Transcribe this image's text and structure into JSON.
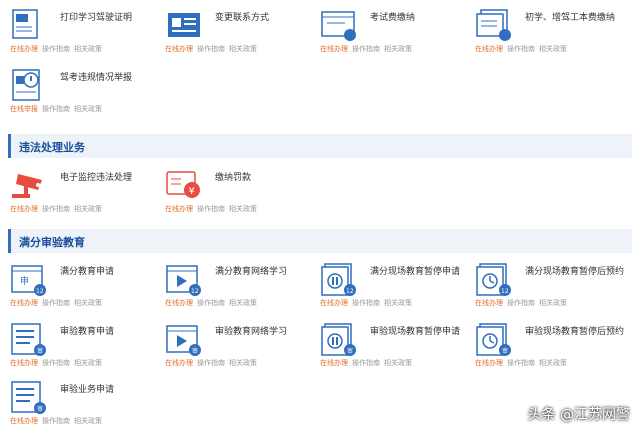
{
  "colors": {
    "accent": "#2f6fbe",
    "online": "#e06f2a",
    "section_bg": "#eef3f9",
    "section_text": "#1b4f9c",
    "icon_red": "#e84c3d"
  },
  "top_items": [
    {
      "title": "打印学习驾驶证明",
      "online": "在线办理",
      "guide": "操作指南",
      "policy": "相关政策",
      "icon": "document-stamp-icon"
    },
    {
      "title": "变更联系方式",
      "online": "在线办理",
      "guide": "操作指南",
      "policy": "相关政策",
      "icon": "contact-card-icon"
    },
    {
      "title": "考试费缴纳",
      "online": "在线办理",
      "guide": "操作指南",
      "policy": "相关政策",
      "icon": "fee-window-icon"
    },
    {
      "title": "初学、增驾工本费缴纳",
      "online": "在线办理",
      "guide": "操作指南",
      "policy": "相关政策",
      "icon": "fee-document-icon"
    },
    {
      "title": "驾考违规情况举报",
      "online": "在线举报",
      "guide": "操作指南",
      "policy": "相关政策",
      "icon": "report-icon"
    }
  ],
  "section_violation": {
    "label": "违法处理业务"
  },
  "violation_items": [
    {
      "title": "电子监控违法处理",
      "online": "在线办理",
      "guide": "操作指南",
      "policy": "相关政策",
      "icon": "camera-icon"
    },
    {
      "title": "缴纳罚款",
      "online": "在线办理",
      "guide": "操作指南",
      "policy": "相关政策",
      "icon": "fine-payment-icon"
    }
  ],
  "section_education": {
    "label": "满分审验教育"
  },
  "education_items": [
    {
      "title": "满分教育申请",
      "online": "在线办理",
      "guide": "操作指南",
      "policy": "相关政策",
      "badge": "12",
      "icon": "apply-window-icon"
    },
    {
      "title": "满分教育网络学习",
      "online": "在线办理",
      "guide": "操作指南",
      "policy": "相关政策",
      "badge": "12",
      "icon": "video-play-icon"
    },
    {
      "title": "满分现场教育暂停申请",
      "online": "在线办理",
      "guide": "操作指南",
      "policy": "相关政策",
      "badge": "12",
      "icon": "pause-icon"
    },
    {
      "title": "满分现场教育暂停后预约",
      "online": "在线办理",
      "guide": "操作指南",
      "policy": "相关政策",
      "badge": "12",
      "icon": "clock-icon"
    },
    {
      "title": "审验教育申请",
      "online": "在线办理",
      "guide": "操作指南",
      "policy": "相关政策",
      "badge": "审",
      "icon": "apply-doc-icon"
    },
    {
      "title": "审验教育网络学习",
      "online": "在线办理",
      "guide": "操作指南",
      "policy": "相关政策",
      "badge": "审",
      "icon": "video-play-icon"
    },
    {
      "title": "审验现场教育暂停申请",
      "online": "在线办理",
      "guide": "操作指南",
      "policy": "相关政策",
      "badge": "审",
      "icon": "pause-icon"
    },
    {
      "title": "审验现场教育暂停后预约",
      "online": "在线办理",
      "guide": "操作指南",
      "policy": "相关政策",
      "badge": "审",
      "icon": "clock-icon"
    },
    {
      "title": "审验业务申请",
      "online": "在线办理",
      "guide": "操作指南",
      "policy": "相关政策",
      "badge": "审",
      "icon": "apply-doc-icon"
    }
  ],
  "watermark": "头条 @江苏网警"
}
